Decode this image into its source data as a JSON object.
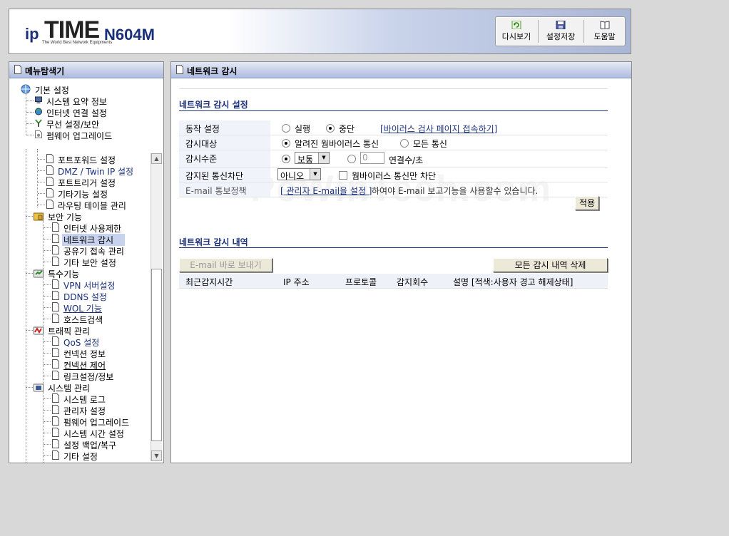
{
  "brand": {
    "ip": "ip",
    "time": "TIME",
    "tagline": "The World Best Network Equipments",
    "model": "N604M"
  },
  "toolbar": {
    "refresh": "다시보기",
    "save": "설정저장",
    "help": "도움말"
  },
  "sidebar": {
    "title": "메뉴탐색기",
    "basic": {
      "label": "기본 설정",
      "items": [
        "시스템 요약 정보",
        "인터넷 연결 설정",
        "무선 설정/보안",
        "펌웨어 업그레이드"
      ]
    },
    "nat_items": [
      "포트포워드 설정",
      "DMZ / Twin IP 설정",
      "포트트리거 설정",
      "기타기능 설정",
      "라우팅 테이블 관리"
    ],
    "security": {
      "label": "보안 기능",
      "items": [
        "인터넷 사용제한",
        "네트워크 감시",
        "공유기 접속 관리",
        "기타 보안 설정"
      ]
    },
    "special": {
      "label": "특수기능",
      "items": [
        "VPN 서버설정",
        "DDNS 설정",
        "WOL 기능",
        "호스트검색"
      ]
    },
    "traffic": {
      "label": "트래픽 관리",
      "items": [
        "QoS 설정",
        "컨넥션 정보",
        "컨넥션 제어",
        "링크설정/정보"
      ]
    },
    "system": {
      "label": "시스템 관리",
      "items": [
        "시스템 로그",
        "관리자 설정",
        "펌웨어 업그레이드",
        "시스템 시간 설정",
        "설정 백업/복구",
        "기타 설정"
      ]
    }
  },
  "main": {
    "title": "네트워크 감시",
    "watermark": "PeWinTech.com",
    "settings": {
      "heading": "네트워크 감시 설정",
      "operation": {
        "label": "동작 설정",
        "opt_run": "실행",
        "opt_stop": "중단",
        "selected": "중단",
        "virus_link": "[바이러스 검사 페이지 접속하기]"
      },
      "target": {
        "label": "감시대상",
        "opt_known": "알려진 웜바이러스 통신",
        "opt_all": "모든 통신",
        "selected": "알려진 웜바이러스 통신"
      },
      "level": {
        "label": "감시수준",
        "select_value": "보통",
        "input_value": "0",
        "unit": "연결수/초"
      },
      "block": {
        "label": "감지된 통신차단",
        "select_value": "아니오",
        "checkbox_label": "웜바이러스 통신만 차단"
      },
      "email": {
        "label": "E-mail 통보정책",
        "link": "[ 관리자 E-mail을 설정 ]",
        "text": "하여야 E-mail 보고기능을 사용할수 있습니다."
      },
      "apply_button": "적용"
    },
    "log": {
      "heading": "네트워크 감시 내역",
      "send_email_button": "E-mail 바로 보내기",
      "delete_all_button": "모든 감시 내역 삭제",
      "columns": [
        "최근감지시간",
        "IP 주소",
        "프로토콜",
        "감지회수",
        "설명 [적색:사용자 경고 해제상태]"
      ]
    }
  }
}
